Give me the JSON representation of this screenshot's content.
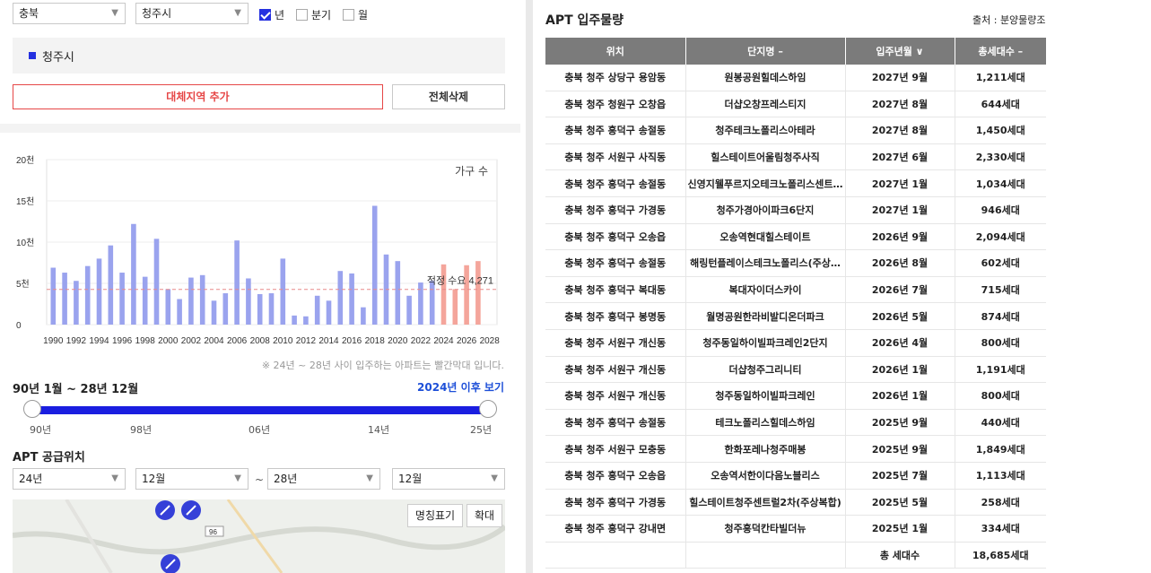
{
  "filters": {
    "province": "충북",
    "city": "청주시",
    "period_options": [
      {
        "label": "년",
        "checked": true
      },
      {
        "label": "분기",
        "checked": false
      },
      {
        "label": "월",
        "checked": false
      }
    ]
  },
  "selected_region": "청주시",
  "buttons": {
    "add_region": "대체지역 추가",
    "delete_all": "전체삭제"
  },
  "chart_data": {
    "type": "bar",
    "legend_label": "가구 수",
    "y_ticks": [
      "0",
      "5천",
      "10천",
      "15천",
      "20천"
    ],
    "ylim": [
      0,
      20000
    ],
    "x_tick_labels": [
      "1990",
      "1992",
      "1994",
      "1996",
      "1998",
      "2000",
      "2002",
      "2004",
      "2006",
      "2008",
      "2010",
      "2012",
      "2014",
      "2016",
      "2018",
      "2020",
      "2022",
      "2024",
      "2026",
      "2028"
    ],
    "categories": [
      1990,
      1991,
      1992,
      1993,
      1994,
      1995,
      1996,
      1997,
      1998,
      1999,
      2000,
      2001,
      2002,
      2003,
      2004,
      2005,
      2006,
      2007,
      2008,
      2009,
      2010,
      2011,
      2012,
      2013,
      2014,
      2015,
      2016,
      2017,
      2018,
      2019,
      2020,
      2021,
      2022,
      2023,
      2024,
      2025,
      2026,
      2027
    ],
    "values": [
      6900,
      6300,
      5300,
      7100,
      8000,
      9600,
      6300,
      12200,
      5800,
      10400,
      4300,
      3100,
      5700,
      6000,
      2900,
      3800,
      10200,
      5600,
      3700,
      3800,
      8000,
      1100,
      1000,
      3500,
      2900,
      6500,
      6200,
      2100,
      14400,
      8500,
      7700,
      3500,
      5100,
      5300,
      7300,
      4300,
      7200,
      7700
    ],
    "highlight_from": 2024,
    "reference": {
      "label": "적정 수요 4,271",
      "value": 4271
    },
    "colors": {
      "normal": "#9aa3ee",
      "future": "#f4a59b",
      "reference": "#e88a8a"
    }
  },
  "note": "※ 24년 ~ 28년 사이 입주하는 아파트는 빨간막대 입니다.",
  "range": {
    "title": "90년 1월 ~ 28년 12월",
    "link": "2024년 이후 보기",
    "labels": [
      "90년",
      "98년",
      "06년",
      "14년",
      "25년"
    ]
  },
  "supply": {
    "title": "APT 공급위치",
    "from_year": "24년",
    "from_month": "12월",
    "tilde": "~",
    "to_year": "28년",
    "to_month": "12월",
    "map_buttons": {
      "labels": "명칭표기",
      "expand": "확대"
    }
  },
  "apt": {
    "title": "APT 입주물량",
    "source": "출처 : 분양물량조사",
    "headers": [
      "위치",
      "단지명 –",
      "입주년월 ∨",
      "총세대수 –"
    ],
    "rows": [
      [
        "충북 청주 상당구 용암동",
        "원봉공원힐데스하임",
        "2027년 9월",
        "1,211세대"
      ],
      [
        "충북 청주 청원구 오창읍",
        "더샵오창프레스티지",
        "2027년 8월",
        "644세대"
      ],
      [
        "충북 청주 흥덕구 송절동",
        "청주테크노폴리스아테라",
        "2027년 8월",
        "1,450세대"
      ],
      [
        "충북 청주 서원구 사직동",
        "힐스테이트어울림청주사직",
        "2027년 6월",
        "2,330세대"
      ],
      [
        "충북 청주 흥덕구 송절동",
        "신영지웰푸르지오테크노폴리스센트…",
        "2027년 1월",
        "1,034세대"
      ],
      [
        "충북 청주 흥덕구 가경동",
        "청주가경아이파크6단지",
        "2027년 1월",
        "946세대"
      ],
      [
        "충북 청주 흥덕구 오송읍",
        "오송역현대힐스테이트",
        "2026년 9월",
        "2,094세대"
      ],
      [
        "충북 청주 흥덕구 송절동",
        "해링턴플레이스테크노폴리스(주상…",
        "2026년 8월",
        "602세대"
      ],
      [
        "충북 청주 흥덕구 복대동",
        "복대자이더스카이",
        "2026년 7월",
        "715세대"
      ],
      [
        "충북 청주 흥덕구 봉명동",
        "월명공원한라비발디온더파크",
        "2026년 5월",
        "874세대"
      ],
      [
        "충북 청주 서원구 개신동",
        "청주동일하이빌파크레인2단지",
        "2026년 4월",
        "800세대"
      ],
      [
        "충북 청주 서원구 개신동",
        "더샵청주그리니티",
        "2026년 1월",
        "1,191세대"
      ],
      [
        "충북 청주 서원구 개신동",
        "청주동일하이빌파크레인",
        "2026년 1월",
        "800세대"
      ],
      [
        "충북 청주 흥덕구 송절동",
        "테크노폴리스힐데스하임",
        "2025년 9월",
        "440세대"
      ],
      [
        "충북 청주 서원구 모충동",
        "한화포레나청주매봉",
        "2025년 9월",
        "1,849세대"
      ],
      [
        "충북 청주 흥덕구 오송읍",
        "오송역서한이다음노블리스",
        "2025년 7월",
        "1,113세대"
      ],
      [
        "충북 청주 흥덕구 가경동",
        "힐스테이트청주센트럴2차(주상복합)",
        "2025년 5월",
        "258세대"
      ],
      [
        "충북 청주 흥덕구 강내면",
        "청주흥덕칸타빌더뉴",
        "2025년 1월",
        "334세대"
      ]
    ],
    "total_label": "총 세대수",
    "total_value": "18,685세대"
  }
}
